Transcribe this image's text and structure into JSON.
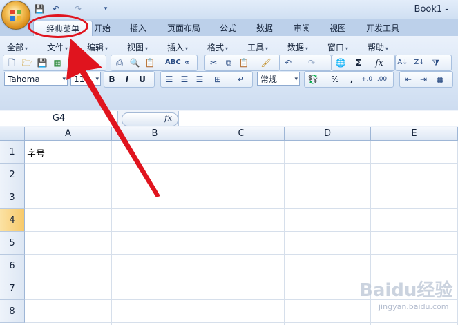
{
  "window": {
    "title": "Book1 -"
  },
  "quick_access": [
    "save-icon",
    "undo-icon",
    "redo-icon",
    "customize-icon"
  ],
  "ribbon_tabs": [
    "经典菜单",
    "开始",
    "插入",
    "页面布局",
    "公式",
    "数据",
    "审阅",
    "视图",
    "开发工具"
  ],
  "classic_menu": {
    "items": [
      "全部",
      "文件",
      "编辑",
      "视图",
      "插入",
      "格式",
      "工具",
      "数据",
      "窗口",
      "帮助"
    ]
  },
  "toolbar": {
    "font_name": "Tahoma",
    "font_size": "11",
    "bold": "B",
    "italic": "I",
    "underline": "U",
    "number_format": "常规",
    "percent": "%",
    "comma": ",",
    "sum": "Σ",
    "fx": "fx"
  },
  "formula_bar": {
    "name_box": "G4",
    "fx_label": "fx",
    "formula": ""
  },
  "columns": [
    "A",
    "B",
    "C",
    "D",
    "E"
  ],
  "rows": [
    "1",
    "2",
    "3",
    "4",
    "5",
    "6",
    "7",
    "8"
  ],
  "active_row": "4",
  "cells": {
    "A1": "字号"
  },
  "watermark": {
    "main": "Baidu经验",
    "sub": "jingyan.baidu.com"
  },
  "colors": {
    "annotation": "#e0141e",
    "active_row_header": "#f7c96a"
  }
}
